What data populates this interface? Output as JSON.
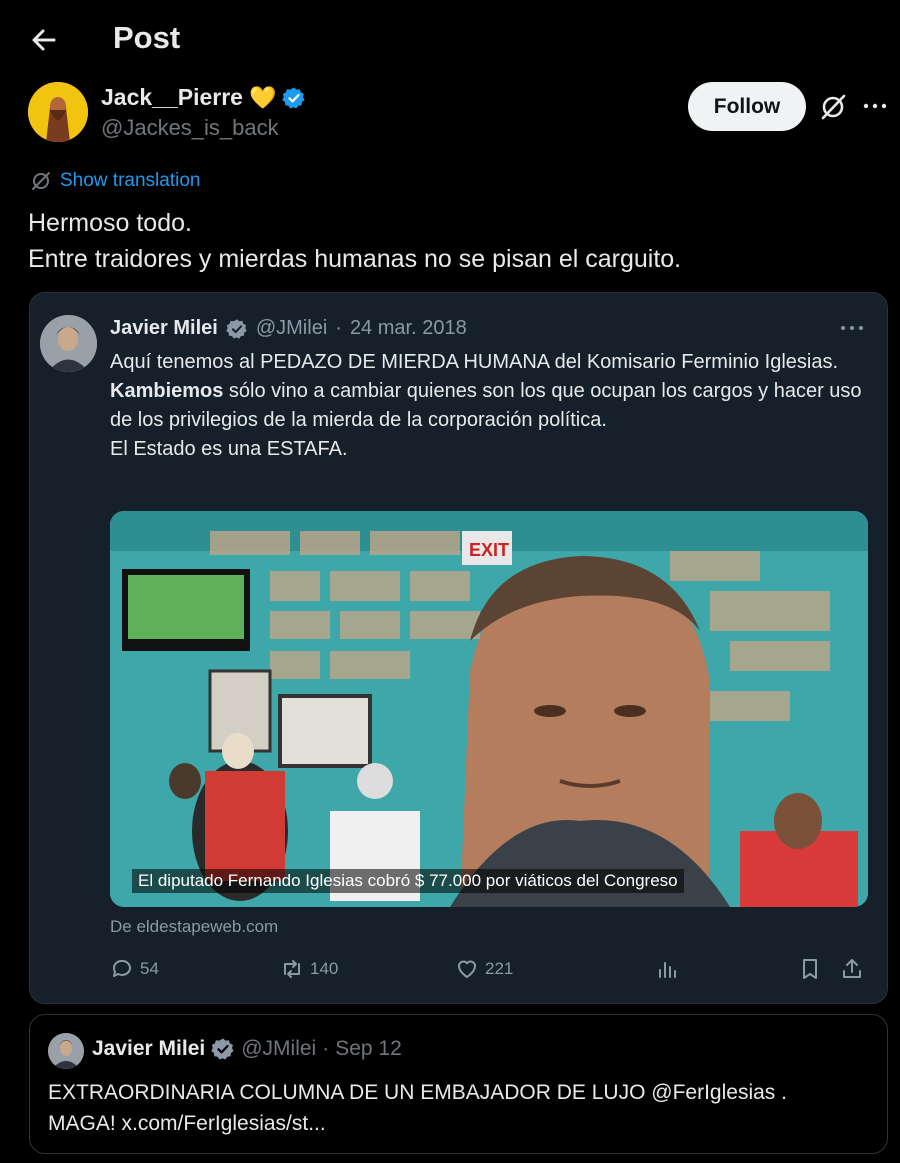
{
  "header": {
    "title": "Post"
  },
  "author": {
    "name": "Jack__Pierre",
    "emoji": "💛",
    "handle": "@Jackes_is_back",
    "follow_label": "Follow"
  },
  "translation": {
    "label": "Show translation"
  },
  "post": {
    "line1": "Hermoso todo.",
    "line2": "Entre traidores y mierdas humanas no se pisan el carguito."
  },
  "quoted": {
    "name": "Javier Milei",
    "handle": "@JMilei",
    "separator": "·",
    "date": "24 mar. 2018",
    "text_line1": "Aquí tenemos al PEDAZO DE MIERDA HUMANA del Komisario Ferminio Iglesias.",
    "bold_word": "Kambiemos",
    "text_line2": " sólo vino a cambiar quienes son los que ocupan los cargos y hacer uso de los privilegios de la mierda de la corporación política.",
    "text_line3": "El Estado es una ESTAFA.",
    "image_caption": "El diputado Fernando Iglesias cobró $ 77.000 por viáticos del Congreso",
    "sign_text": "EXIT",
    "source": "De eldestapeweb.com",
    "actions": {
      "replies": "54",
      "reposts": "140",
      "likes": "221"
    }
  },
  "quoted2": {
    "name": "Javier Milei",
    "handle": "@JMilei",
    "separator": "·",
    "date": "Sep 12",
    "text_line1": "EXTRAORDINARIA COLUMNA DE UN EMBAJADOR DE LUJO @FerIglesias .",
    "text_line2": "MAGA! x.com/FerIglesias/st..."
  },
  "colors": {
    "background": "#000000",
    "link": "#1d9bf0",
    "verified": "#1d9bf0",
    "card": "#15202b",
    "muted": "#71767b"
  },
  "icons": [
    "back-arrow-icon",
    "verified-badge-icon",
    "grok-icon",
    "more-icon",
    "translate-icon",
    "reply-icon",
    "repost-icon",
    "like-icon",
    "views-icon",
    "bookmark-icon",
    "share-icon"
  ]
}
